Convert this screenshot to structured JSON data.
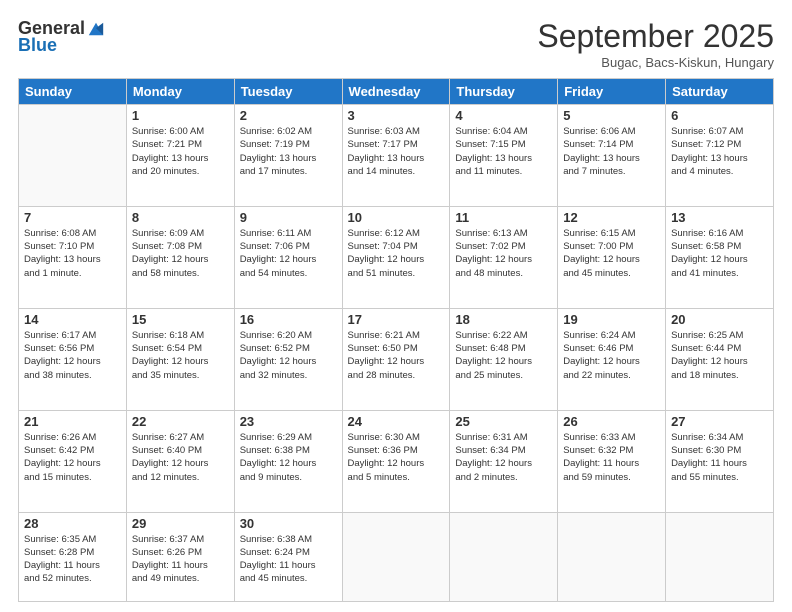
{
  "logo": {
    "general": "General",
    "blue": "Blue"
  },
  "title": "September 2025",
  "location": "Bugac, Bacs-Kiskun, Hungary",
  "days_of_week": [
    "Sunday",
    "Monday",
    "Tuesday",
    "Wednesday",
    "Thursday",
    "Friday",
    "Saturday"
  ],
  "weeks": [
    [
      {
        "day": "",
        "info": ""
      },
      {
        "day": "1",
        "info": "Sunrise: 6:00 AM\nSunset: 7:21 PM\nDaylight: 13 hours\nand 20 minutes."
      },
      {
        "day": "2",
        "info": "Sunrise: 6:02 AM\nSunset: 7:19 PM\nDaylight: 13 hours\nand 17 minutes."
      },
      {
        "day": "3",
        "info": "Sunrise: 6:03 AM\nSunset: 7:17 PM\nDaylight: 13 hours\nand 14 minutes."
      },
      {
        "day": "4",
        "info": "Sunrise: 6:04 AM\nSunset: 7:15 PM\nDaylight: 13 hours\nand 11 minutes."
      },
      {
        "day": "5",
        "info": "Sunrise: 6:06 AM\nSunset: 7:14 PM\nDaylight: 13 hours\nand 7 minutes."
      },
      {
        "day": "6",
        "info": "Sunrise: 6:07 AM\nSunset: 7:12 PM\nDaylight: 13 hours\nand 4 minutes."
      }
    ],
    [
      {
        "day": "7",
        "info": "Sunrise: 6:08 AM\nSunset: 7:10 PM\nDaylight: 13 hours\nand 1 minute."
      },
      {
        "day": "8",
        "info": "Sunrise: 6:09 AM\nSunset: 7:08 PM\nDaylight: 12 hours\nand 58 minutes."
      },
      {
        "day": "9",
        "info": "Sunrise: 6:11 AM\nSunset: 7:06 PM\nDaylight: 12 hours\nand 54 minutes."
      },
      {
        "day": "10",
        "info": "Sunrise: 6:12 AM\nSunset: 7:04 PM\nDaylight: 12 hours\nand 51 minutes."
      },
      {
        "day": "11",
        "info": "Sunrise: 6:13 AM\nSunset: 7:02 PM\nDaylight: 12 hours\nand 48 minutes."
      },
      {
        "day": "12",
        "info": "Sunrise: 6:15 AM\nSunset: 7:00 PM\nDaylight: 12 hours\nand 45 minutes."
      },
      {
        "day": "13",
        "info": "Sunrise: 6:16 AM\nSunset: 6:58 PM\nDaylight: 12 hours\nand 41 minutes."
      }
    ],
    [
      {
        "day": "14",
        "info": "Sunrise: 6:17 AM\nSunset: 6:56 PM\nDaylight: 12 hours\nand 38 minutes."
      },
      {
        "day": "15",
        "info": "Sunrise: 6:18 AM\nSunset: 6:54 PM\nDaylight: 12 hours\nand 35 minutes."
      },
      {
        "day": "16",
        "info": "Sunrise: 6:20 AM\nSunset: 6:52 PM\nDaylight: 12 hours\nand 32 minutes."
      },
      {
        "day": "17",
        "info": "Sunrise: 6:21 AM\nSunset: 6:50 PM\nDaylight: 12 hours\nand 28 minutes."
      },
      {
        "day": "18",
        "info": "Sunrise: 6:22 AM\nSunset: 6:48 PM\nDaylight: 12 hours\nand 25 minutes."
      },
      {
        "day": "19",
        "info": "Sunrise: 6:24 AM\nSunset: 6:46 PM\nDaylight: 12 hours\nand 22 minutes."
      },
      {
        "day": "20",
        "info": "Sunrise: 6:25 AM\nSunset: 6:44 PM\nDaylight: 12 hours\nand 18 minutes."
      }
    ],
    [
      {
        "day": "21",
        "info": "Sunrise: 6:26 AM\nSunset: 6:42 PM\nDaylight: 12 hours\nand 15 minutes."
      },
      {
        "day": "22",
        "info": "Sunrise: 6:27 AM\nSunset: 6:40 PM\nDaylight: 12 hours\nand 12 minutes."
      },
      {
        "day": "23",
        "info": "Sunrise: 6:29 AM\nSunset: 6:38 PM\nDaylight: 12 hours\nand 9 minutes."
      },
      {
        "day": "24",
        "info": "Sunrise: 6:30 AM\nSunset: 6:36 PM\nDaylight: 12 hours\nand 5 minutes."
      },
      {
        "day": "25",
        "info": "Sunrise: 6:31 AM\nSunset: 6:34 PM\nDaylight: 12 hours\nand 2 minutes."
      },
      {
        "day": "26",
        "info": "Sunrise: 6:33 AM\nSunset: 6:32 PM\nDaylight: 11 hours\nand 59 minutes."
      },
      {
        "day": "27",
        "info": "Sunrise: 6:34 AM\nSunset: 6:30 PM\nDaylight: 11 hours\nand 55 minutes."
      }
    ],
    [
      {
        "day": "28",
        "info": "Sunrise: 6:35 AM\nSunset: 6:28 PM\nDaylight: 11 hours\nand 52 minutes."
      },
      {
        "day": "29",
        "info": "Sunrise: 6:37 AM\nSunset: 6:26 PM\nDaylight: 11 hours\nand 49 minutes."
      },
      {
        "day": "30",
        "info": "Sunrise: 6:38 AM\nSunset: 6:24 PM\nDaylight: 11 hours\nand 45 minutes."
      },
      {
        "day": "",
        "info": ""
      },
      {
        "day": "",
        "info": ""
      },
      {
        "day": "",
        "info": ""
      },
      {
        "day": "",
        "info": ""
      }
    ]
  ]
}
